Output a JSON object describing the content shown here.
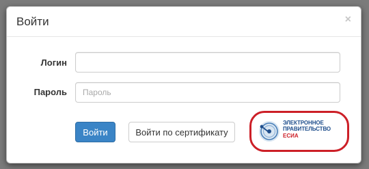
{
  "dialog": {
    "title": "Войти",
    "close_label": "×"
  },
  "form": {
    "login": {
      "label": "Логин",
      "value": "",
      "placeholder": ""
    },
    "password": {
      "label": "Пароль",
      "value": "",
      "placeholder": "Пароль"
    }
  },
  "buttons": {
    "login_label": "Войти",
    "certificate_label": "Войти по сертификату"
  },
  "esia": {
    "line1": "ЭЛЕКТРОННОЕ",
    "line2": "ПРАВИТЕЛЬСТВО",
    "line3": "ЕСИА"
  },
  "colors": {
    "primary": "#3a84c6",
    "esia_blue": "#1f4e8c",
    "esia_red": "#cc1f27",
    "highlight_ring": "#cc1f27"
  }
}
